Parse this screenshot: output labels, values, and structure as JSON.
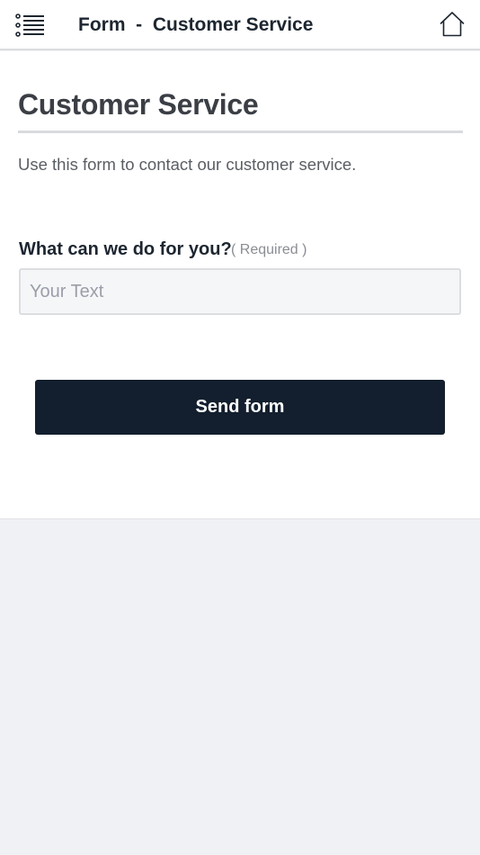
{
  "header": {
    "title": "Form  -  Customer Service",
    "menu_icon": "list-menu-icon",
    "home_icon": "home-icon"
  },
  "form": {
    "title": "Customer Service",
    "intro": "Use this form to contact our customer service.",
    "field": {
      "label": "What can we do for you?",
      "hint": "( Required )",
      "placeholder": "Your Text",
      "value": ""
    },
    "submit_label": "Send form"
  },
  "colors": {
    "button_bg": "#131f2e",
    "page_bg": "#f0f1f5",
    "panel_bg": "#ffffff",
    "title_text": "#3b3f45"
  }
}
